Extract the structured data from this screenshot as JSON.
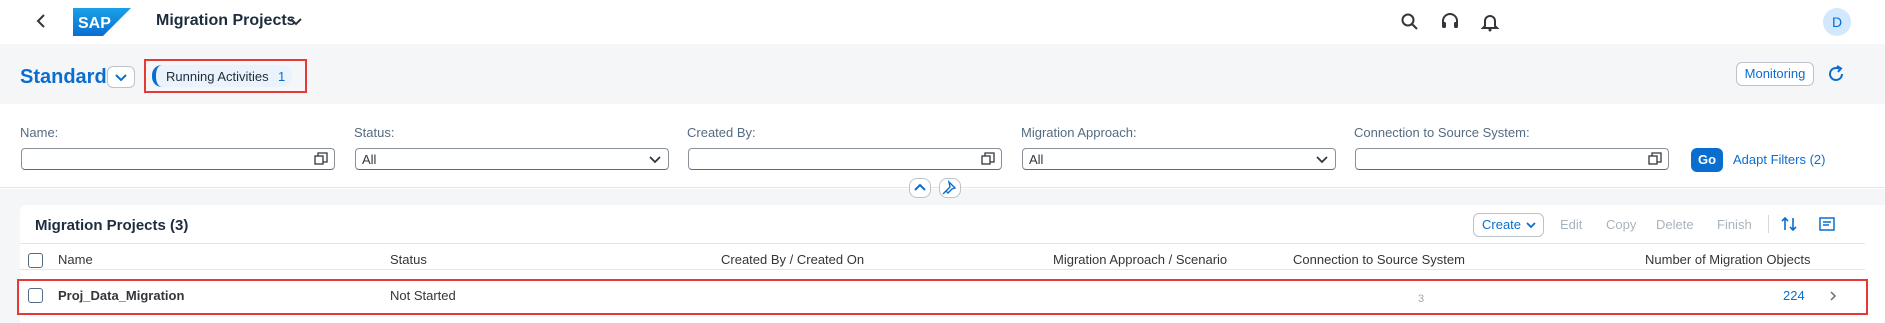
{
  "shell": {
    "app_title": "Migration Projects",
    "logo_text": "SAP",
    "avatar_initial": "D",
    "icons": [
      "back-icon",
      "chevron-down-icon",
      "search-icon",
      "headset-icon",
      "bell-icon"
    ]
  },
  "header": {
    "variant_name": "Standard",
    "running_activities_label": "Running Activities",
    "running_activities_count": "1",
    "monitoring_label": "Monitoring"
  },
  "filters": {
    "name_label": "Name:",
    "name_value": "",
    "status_label": "Status:",
    "status_value": "All",
    "created_by_label": "Created By:",
    "created_by_value": "",
    "approach_label": "Migration Approach:",
    "approach_value": "All",
    "connection_label": "Connection to Source System:",
    "connection_value": "",
    "go_label": "Go",
    "adapt_label": "Adapt Filters (2)"
  },
  "table": {
    "title": "Migration Projects (3)",
    "toolbar": {
      "create": "Create",
      "edit": "Edit",
      "copy": "Copy",
      "delete": "Delete",
      "finish": "Finish"
    },
    "columns": {
      "name": "Name",
      "status": "Status",
      "created": "Created By / Created On",
      "approach": "Migration Approach / Scenario",
      "connection": "Connection to Source System",
      "objects": "Number of Migration Objects"
    },
    "rows": [
      {
        "name": "Proj_Data_Migration",
        "status": "Not Started",
        "connection_suffix": "3",
        "objects": "224"
      }
    ]
  },
  "colors": {
    "accent": "#0a6ed1",
    "highlight": "#e53935",
    "header_bg": "#f5f6f7"
  }
}
